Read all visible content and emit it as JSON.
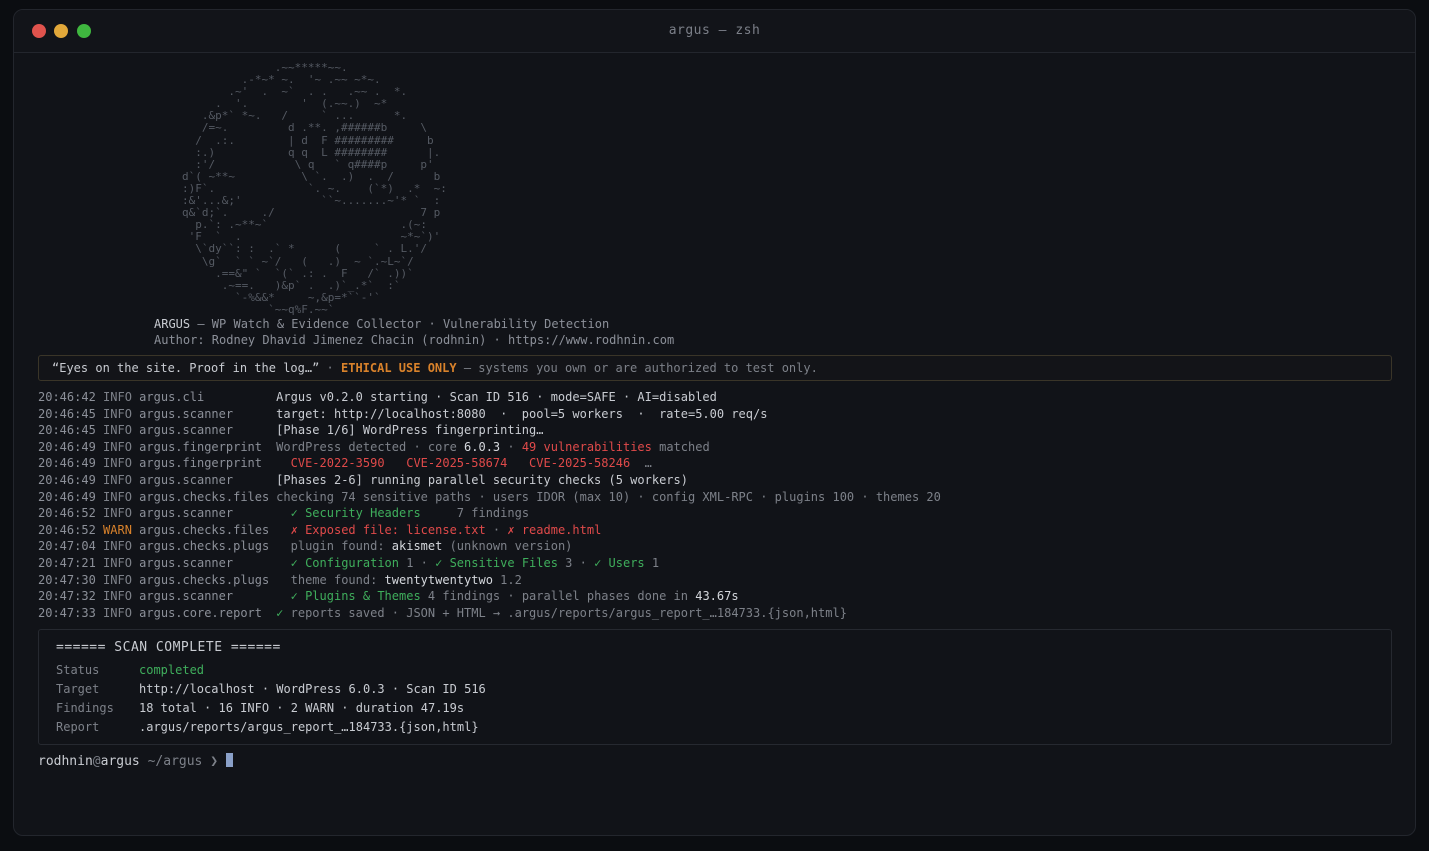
{
  "window": {
    "title": "argus — zsh"
  },
  "banner": {
    "ascii_art": "              .~~*****~~. \n         .-*~* ~.  '~ .~~ ~*~.\n       .~'  .  ~`  . .   .~~ .  *.\n     .  '.        '  (.~~.)  ~*  \n   .&p*` *~.   /     ` ...      *.\n   /=~.         d .**. ,######b     \\\n  /  .:.        | d  F #########     b\n  :.)           q q  L ########      |.\n  :'/            \\ q   ` q####p     p'\nd`( ~**~          \\ `.  .)  .  /      b\n:)F`.              `. ~.    (`*)  .*  ~:\n:&'...&;'            ``~.......~'* `  :\nq&`d;`.     ./                      7 p\n  p.`: .~**~`                    .(~:\n 'F  `  .                        ~*~`)'\n  \\`dy``: :  .` *      (     ` . L.'/\n   \\g`  ` ` ~`/   (   .)  ~ `.~L~`/\n     .==&\" `  `(` .: .  F   /` .))`\n      .~==.   )&p` .  .)`_.*`  :`\n        `-%&&*     ~,&p=*``-'`\n             `~~q%F.~~`",
    "name": "ARGUS",
    "subtitle": "— WP Watch & Evidence Collector · Vulnerability Detection",
    "author": "Author: Rodney Dhavid Jimenez Chacin (rodhnin) · https://www.rodhnin.com"
  },
  "motto": {
    "quote": "“Eyes on the site. Proof in the log…”",
    "sep": " · ",
    "ethical": "ETHICAL USE ONLY",
    "rest": " — systems you own or are authorized to test only."
  },
  "log": [
    {
      "ts": "20:46:42",
      "level": "INFO",
      "module": "argus.cli",
      "parts": [
        {
          "t": "Argus v0.2.0 starting · Scan ID 516 · mode=SAFE · AI=disabled",
          "c": "msg"
        }
      ]
    },
    {
      "ts": "20:46:45",
      "level": "INFO",
      "module": "argus.scanner",
      "parts": [
        {
          "t": "target: http://localhost:8080  ·  pool=5 workers  ·  rate=5.00 req/s",
          "c": "msg"
        }
      ]
    },
    {
      "ts": "20:46:45",
      "level": "INFO",
      "module": "argus.scanner",
      "parts": [
        {
          "t": "[Phase 1/6] WordPress fingerprinting…",
          "c": "msg"
        }
      ]
    },
    {
      "ts": "20:46:49",
      "level": "INFO",
      "module": "argus.fingerprint",
      "parts": [
        {
          "t": "WordPress detected · core ",
          "c": "dim"
        },
        {
          "t": "6.0.3",
          "c": "bright"
        },
        {
          "t": " · ",
          "c": "dim"
        },
        {
          "t": "49 vulnerabilities",
          "c": "red"
        },
        {
          "t": " matched",
          "c": "dim"
        }
      ]
    },
    {
      "ts": "20:46:49",
      "level": "INFO",
      "module": "argus.fingerprint",
      "parts": [
        {
          "t": "  CVE-2022-3590   CVE-2025-58674   CVE-2025-58246",
          "c": "red"
        },
        {
          "t": "  …",
          "c": "dim"
        }
      ]
    },
    {
      "ts": "20:46:49",
      "level": "INFO",
      "module": "argus.scanner",
      "parts": [
        {
          "t": "[Phases 2-6] running parallel security checks (5 workers)",
          "c": "msg"
        }
      ]
    },
    {
      "ts": "20:46:49",
      "level": "INFO",
      "module": "argus.checks.files",
      "parts": [
        {
          "t": "checking 74 sensitive paths · users IDOR (max 10) · config XML-RPC · plugins 100 · themes 20",
          "c": "dim"
        }
      ]
    },
    {
      "ts": "20:46:52",
      "level": "INFO",
      "module": "argus.scanner",
      "parts": [
        {
          "t": "  ✓ Security Headers",
          "c": "green"
        },
        {
          "t": "     7 findings",
          "c": "dim"
        }
      ]
    },
    {
      "ts": "20:46:52",
      "level": "WARN",
      "module": "argus.checks.files",
      "parts": [
        {
          "t": "  ✗ Exposed file: license.txt",
          "c": "red"
        },
        {
          "t": " · ",
          "c": "dim"
        },
        {
          "t": "✗ readme.html",
          "c": "red"
        }
      ]
    },
    {
      "ts": "20:47:04",
      "level": "INFO",
      "module": "argus.checks.plugs",
      "parts": [
        {
          "t": "  plugin found: ",
          "c": "dim"
        },
        {
          "t": "akismet",
          "c": "bright"
        },
        {
          "t": " (unknown version)",
          "c": "dim"
        }
      ]
    },
    {
      "ts": "20:47:21",
      "level": "INFO",
      "module": "argus.scanner",
      "parts": [
        {
          "t": "  ✓ Configuration",
          "c": "green"
        },
        {
          "t": " 1 · ",
          "c": "dim"
        },
        {
          "t": "✓ Sensitive Files",
          "c": "green"
        },
        {
          "t": " 3 · ",
          "c": "dim"
        },
        {
          "t": "✓ Users",
          "c": "green"
        },
        {
          "t": " 1",
          "c": "dim"
        }
      ]
    },
    {
      "ts": "20:47:30",
      "level": "INFO",
      "module": "argus.checks.plugs",
      "parts": [
        {
          "t": "  theme found: ",
          "c": "dim"
        },
        {
          "t": "twentytwentytwo",
          "c": "bright"
        },
        {
          "t": " 1.2",
          "c": "dim"
        }
      ]
    },
    {
      "ts": "20:47:32",
      "level": "INFO",
      "module": "argus.scanner",
      "parts": [
        {
          "t": "  ✓ Plugins & Themes",
          "c": "green"
        },
        {
          "t": " 4 findings · parallel phases done in ",
          "c": "dim"
        },
        {
          "t": "43.67s",
          "c": "bright"
        }
      ]
    },
    {
      "ts": "20:47:33",
      "level": "INFO",
      "module": "argus.core.report",
      "parts": [
        {
          "t": "✓",
          "c": "green"
        },
        {
          "t": " reports saved · JSON + HTML → .argus/reports/argus_report_…184733.{json,html}",
          "c": "dim"
        }
      ]
    }
  ],
  "summary": {
    "title": "====== SCAN COMPLETE ======",
    "rows": [
      {
        "key": "Status",
        "value": "completed",
        "ok": true
      },
      {
        "key": "Target",
        "value": "http://localhost · WordPress 6.0.3 · Scan ID 516",
        "ok": false
      },
      {
        "key": "Findings",
        "value": "18 total · 16 INFO · 2 WARN · duration 47.19s",
        "ok": false
      },
      {
        "key": "Report",
        "value": ".argus/reports/argus_report_…184733.{json,html}",
        "ok": false
      }
    ]
  },
  "prompt": {
    "user": "rodhnin",
    "at": "@",
    "host": "argus",
    "path": " ~/argus",
    "arrow": " ❯ "
  },
  "colors": {
    "red": "#e04a4a",
    "green": "#3fae5c",
    "warn": "#d9822b",
    "background": "#111318"
  }
}
